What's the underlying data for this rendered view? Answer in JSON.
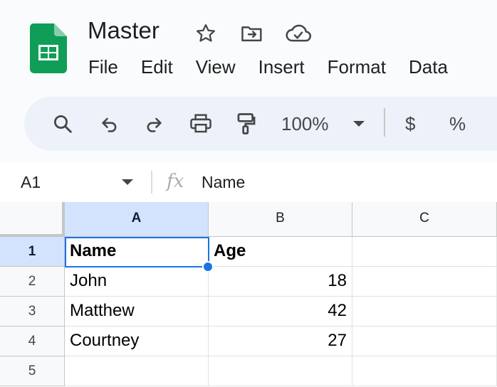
{
  "app": {
    "title": "Master",
    "icons": [
      "sheets-logo",
      "star-icon",
      "move-to-folder-icon",
      "cloud-saved-icon"
    ],
    "brand_color": "#0f9d58"
  },
  "menu": {
    "items": [
      "File",
      "Edit",
      "View",
      "Insert",
      "Format",
      "Data"
    ]
  },
  "toolbar": {
    "zoom": "100%",
    "currency_label": "$",
    "percent_label": "%",
    "icons": [
      "search-icon",
      "undo-icon",
      "redo-icon",
      "print-icon",
      "paint-format-icon",
      "dropdown-arrow-icon"
    ]
  },
  "formula_bar": {
    "cell_ref": "A1",
    "fx_label": "fx",
    "value": "Name"
  },
  "grid": {
    "columns": [
      "A",
      "B",
      "C"
    ],
    "rows": [
      "1",
      "2",
      "3",
      "4",
      "5"
    ],
    "cells": [
      [
        "Name",
        "Age",
        ""
      ],
      [
        "John",
        "18",
        ""
      ],
      [
        "Matthew",
        "42",
        ""
      ],
      [
        "Courtney",
        "27",
        ""
      ],
      [
        "",
        "",
        ""
      ]
    ],
    "selected_cell": "A1",
    "selection_color": "#1a73e8"
  }
}
